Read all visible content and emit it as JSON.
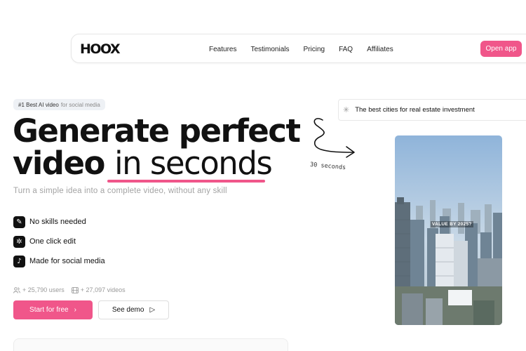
{
  "header": {
    "logo": "HOOX",
    "nav": [
      "Features",
      "Testimonials",
      "Pricing",
      "FAQ",
      "Affiliates"
    ],
    "cta": "Open app"
  },
  "hero": {
    "badge_strong": "#1 Best AI video",
    "badge_muted": "for social media",
    "headline_line1": "Generate perfect",
    "headline_line2_bold": "video ",
    "headline_line2_light": "in seconds",
    "subtitle": "Turn a simple idea into a complete video, without any skill",
    "features": [
      {
        "icon": "compass-icon",
        "glyph": "✎",
        "label": "No skills needed"
      },
      {
        "icon": "magic-click-icon",
        "glyph": "✲",
        "label": "One click edit"
      },
      {
        "icon": "tiktok-icon",
        "glyph": "♪",
        "label": "Made for social media"
      }
    ],
    "stats": {
      "users": "+ 25,790 users",
      "videos": "+ 27,097 videos"
    },
    "primary_button": "Start for free",
    "primary_button_icon": "›",
    "secondary_button": "See demo",
    "secondary_button_icon": "▷"
  },
  "demo": {
    "prompt": "The best cities for real estate investment",
    "hand_label": "30 seconds",
    "video_caption": "VALUE BY 2025?"
  },
  "colors": {
    "accent": "#f0568a",
    "text": "#111111",
    "muted": "#a3a3a3"
  }
}
